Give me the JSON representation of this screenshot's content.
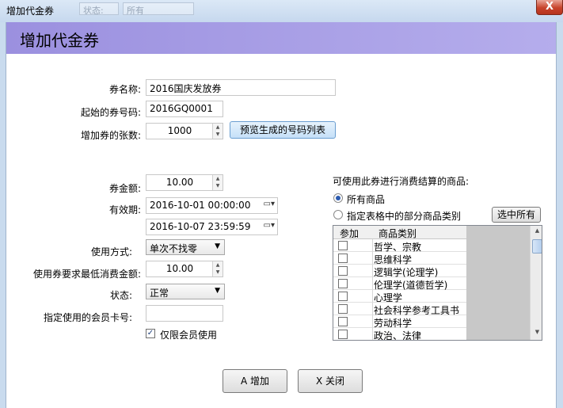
{
  "window": {
    "title": "增加代金券",
    "close_glyph": "X"
  },
  "header": {
    "title": "增加代金券"
  },
  "background_ghost": [
    "状态:",
    "所有"
  ],
  "form": {
    "coupon_name": {
      "label": "券名称:",
      "value": "2016国庆发放券"
    },
    "start_number": {
      "label": "起始的券号码:",
      "value": "2016GQ0001"
    },
    "count": {
      "label": "增加券的张数:",
      "value": "1000"
    },
    "preview_button": "预览生成的号码列表",
    "amount": {
      "label": "券金额:",
      "value": "10.00"
    },
    "validity": {
      "label": "有效期:",
      "start": "2016-10-01 00:00:00",
      "end": "2016-10-07 23:59:59"
    },
    "usage": {
      "label": "使用方式:",
      "value": "单次不找零"
    },
    "min_spend": {
      "label": "使用券要求最低消费金额:",
      "value": "10.00"
    },
    "status": {
      "label": "状态:",
      "value": "正常"
    },
    "member_card": {
      "label": "指定使用的会员卡号:",
      "value": ""
    },
    "members_only": {
      "label": "仅限会员使用",
      "checked": true
    }
  },
  "goods": {
    "title": "可使用此券进行消费结算的商品:",
    "option_all": "所有商品",
    "option_partial": "指定表格中的部分商品类别",
    "selected_option": "all",
    "select_all_button": "选中所有",
    "columns": [
      "参加",
      "商品类别"
    ],
    "rows": [
      "哲学、宗教",
      "思维科学",
      "逻辑学(论理学)",
      "伦理学(道德哲学)",
      "心理学",
      "社会科学参考工具书",
      "劳动科学",
      "政治、法律"
    ]
  },
  "actions": {
    "add": "A 增加",
    "close": "X 关闭"
  },
  "colors": {
    "header_band": "#9b90df",
    "title_bar": "#c6d8ee",
    "close_button": "#c7432b"
  }
}
